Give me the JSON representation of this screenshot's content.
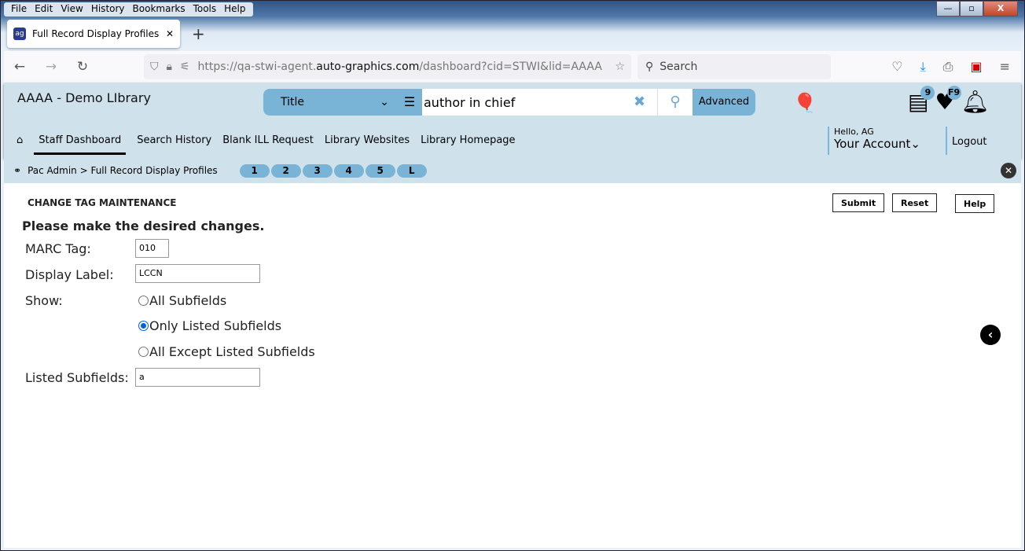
{
  "browser": {
    "menu": [
      "File",
      "Edit",
      "View",
      "History",
      "Bookmarks",
      "Tools",
      "Help"
    ],
    "tab_title": "Full Record Display Profiles | STW",
    "url_pre": "https://qa-stwi-agent.",
    "url_host": "auto-graphics.com",
    "url_post": "/dashboard?cid=STWI&lid=AAAA",
    "search_placeholder": "Search"
  },
  "header": {
    "library": "AAAA - Demo LIbrary",
    "search_type": "Title",
    "query": "author in chief",
    "advanced": "Advanced",
    "list_badge": "9",
    "fav_badge": "F9",
    "hello": "Hello, AG",
    "account": "Your Account",
    "logout": "Logout"
  },
  "menu": [
    "Staff Dashboard",
    "Search History",
    "Blank ILL Request",
    "Library Websites",
    "Library Homepage"
  ],
  "breadcrumb": {
    "text": "Pac Admin > Full Record Display Profiles",
    "pills": [
      "1",
      "2",
      "3",
      "4",
      "5",
      "L"
    ]
  },
  "form": {
    "heading": "CHANGE TAG MAINTENANCE",
    "submit": "Submit",
    "reset": "Reset",
    "help": "Help",
    "instruction": "Please make the desired changes.",
    "marc_label": "MARC Tag:",
    "marc_value": "010",
    "display_label": "Display Label:",
    "display_value": "LCCN",
    "show_label": "Show:",
    "options": [
      "All Subfields",
      "Only Listed Subfields",
      "All Except Listed Subfields"
    ],
    "selected": 1,
    "listed_label": "Listed Subfields:",
    "listed_value": "a"
  },
  "colors": {
    "accent": "#79b4d6",
    "header_bg": "#cfe2ec"
  }
}
